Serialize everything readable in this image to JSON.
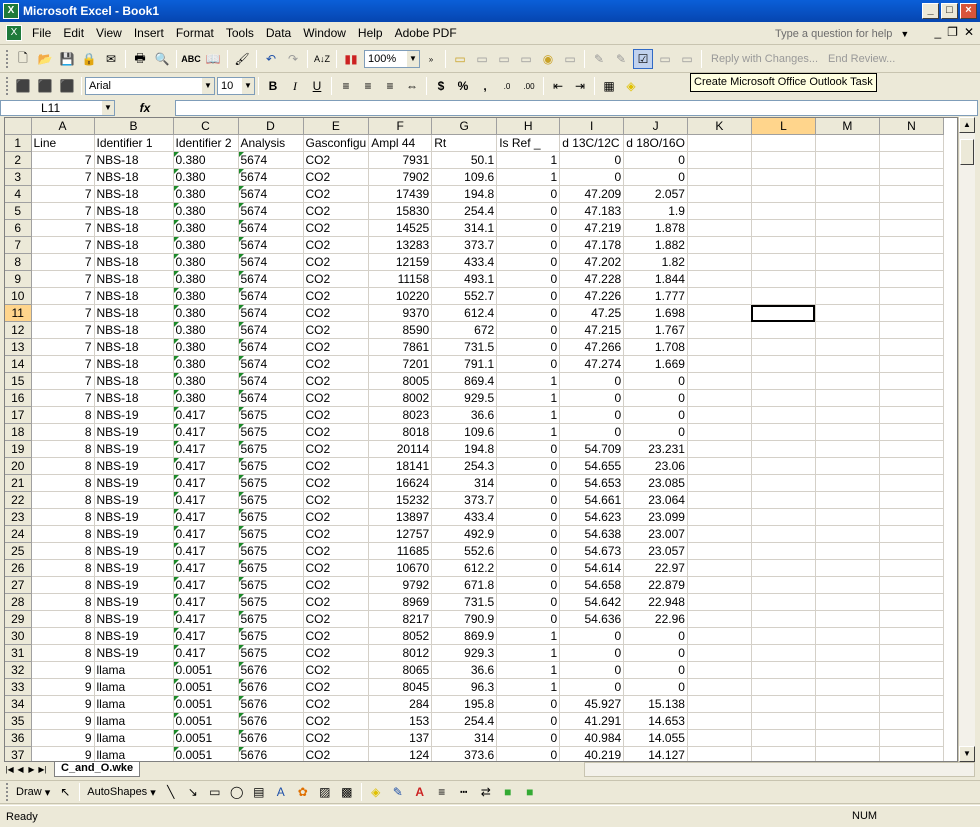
{
  "window": {
    "title": "Microsoft Excel - Book1"
  },
  "menu": [
    "File",
    "Edit",
    "View",
    "Insert",
    "Format",
    "Tools",
    "Data",
    "Window",
    "Help",
    "Adobe PDF"
  ],
  "help": {
    "placeholder": "Type a question for help"
  },
  "toolbar": {
    "zoom": "100%",
    "reply_label": "Reply with Changes...",
    "end_review_label": "End Review...",
    "font": "Arial",
    "size": "10"
  },
  "tooltip": "Create Microsoft Office Outlook Task",
  "namebox": "L11",
  "fx": "fx",
  "columns": [
    "A",
    "B",
    "C",
    "D",
    "E",
    "F",
    "G",
    "H",
    "I",
    "J",
    "K",
    "L",
    "M",
    "N"
  ],
  "rows": [
    [
      "Line",
      "Identifier 1",
      "Identifier 2",
      "Analysis",
      "Gasconfigu",
      "Ampl  44",
      "Rt",
      "Is Ref _",
      "d 13C/12C",
      "d 18O/16O"
    ],
    [
      "7",
      "NBS-18",
      "0.380",
      "5674",
      "CO2",
      "7931",
      "50.1",
      "1",
      "0",
      "0"
    ],
    [
      "7",
      "NBS-18",
      "0.380",
      "5674",
      "CO2",
      "7902",
      "109.6",
      "1",
      "0",
      "0"
    ],
    [
      "7",
      "NBS-18",
      "0.380",
      "5674",
      "CO2",
      "17439",
      "194.8",
      "0",
      "47.209",
      "2.057"
    ],
    [
      "7",
      "NBS-18",
      "0.380",
      "5674",
      "CO2",
      "15830",
      "254.4",
      "0",
      "47.183",
      "1.9"
    ],
    [
      "7",
      "NBS-18",
      "0.380",
      "5674",
      "CO2",
      "14525",
      "314.1",
      "0",
      "47.219",
      "1.878"
    ],
    [
      "7",
      "NBS-18",
      "0.380",
      "5674",
      "CO2",
      "13283",
      "373.7",
      "0",
      "47.178",
      "1.882"
    ],
    [
      "7",
      "NBS-18",
      "0.380",
      "5674",
      "CO2",
      "12159",
      "433.4",
      "0",
      "47.202",
      "1.82"
    ],
    [
      "7",
      "NBS-18",
      "0.380",
      "5674",
      "CO2",
      "11158",
      "493.1",
      "0",
      "47.228",
      "1.844"
    ],
    [
      "7",
      "NBS-18",
      "0.380",
      "5674",
      "CO2",
      "10220",
      "552.7",
      "0",
      "47.226",
      "1.777"
    ],
    [
      "7",
      "NBS-18",
      "0.380",
      "5674",
      "CO2",
      "9370",
      "612.4",
      "0",
      "47.25",
      "1.698"
    ],
    [
      "7",
      "NBS-18",
      "0.380",
      "5674",
      "CO2",
      "8590",
      "672",
      "0",
      "47.215",
      "1.767"
    ],
    [
      "7",
      "NBS-18",
      "0.380",
      "5674",
      "CO2",
      "7861",
      "731.5",
      "0",
      "47.266",
      "1.708"
    ],
    [
      "7",
      "NBS-18",
      "0.380",
      "5674",
      "CO2",
      "7201",
      "791.1",
      "0",
      "47.274",
      "1.669"
    ],
    [
      "7",
      "NBS-18",
      "0.380",
      "5674",
      "CO2",
      "8005",
      "869.4",
      "1",
      "0",
      "0"
    ],
    [
      "7",
      "NBS-18",
      "0.380",
      "5674",
      "CO2",
      "8002",
      "929.5",
      "1",
      "0",
      "0"
    ],
    [
      "8",
      "NBS-19",
      "0.417",
      "5675",
      "CO2",
      "8023",
      "36.6",
      "1",
      "0",
      "0"
    ],
    [
      "8",
      "NBS-19",
      "0.417",
      "5675",
      "CO2",
      "8018",
      "109.6",
      "1",
      "0",
      "0"
    ],
    [
      "8",
      "NBS-19",
      "0.417",
      "5675",
      "CO2",
      "20114",
      "194.8",
      "0",
      "54.709",
      "23.231"
    ],
    [
      "8",
      "NBS-19",
      "0.417",
      "5675",
      "CO2",
      "18141",
      "254.3",
      "0",
      "54.655",
      "23.06"
    ],
    [
      "8",
      "NBS-19",
      "0.417",
      "5675",
      "CO2",
      "16624",
      "314",
      "0",
      "54.653",
      "23.085"
    ],
    [
      "8",
      "NBS-19",
      "0.417",
      "5675",
      "CO2",
      "15232",
      "373.7",
      "0",
      "54.661",
      "23.064"
    ],
    [
      "8",
      "NBS-19",
      "0.417",
      "5675",
      "CO2",
      "13897",
      "433.4",
      "0",
      "54.623",
      "23.099"
    ],
    [
      "8",
      "NBS-19",
      "0.417",
      "5675",
      "CO2",
      "12757",
      "492.9",
      "0",
      "54.638",
      "23.007"
    ],
    [
      "8",
      "NBS-19",
      "0.417",
      "5675",
      "CO2",
      "11685",
      "552.6",
      "0",
      "54.673",
      "23.057"
    ],
    [
      "8",
      "NBS-19",
      "0.417",
      "5675",
      "CO2",
      "10670",
      "612.2",
      "0",
      "54.614",
      "22.97"
    ],
    [
      "8",
      "NBS-19",
      "0.417",
      "5675",
      "CO2",
      "9792",
      "671.8",
      "0",
      "54.658",
      "22.879"
    ],
    [
      "8",
      "NBS-19",
      "0.417",
      "5675",
      "CO2",
      "8969",
      "731.5",
      "0",
      "54.642",
      "22.948"
    ],
    [
      "8",
      "NBS-19",
      "0.417",
      "5675",
      "CO2",
      "8217",
      "790.9",
      "0",
      "54.636",
      "22.96"
    ],
    [
      "8",
      "NBS-19",
      "0.417",
      "5675",
      "CO2",
      "8052",
      "869.9",
      "1",
      "0",
      "0"
    ],
    [
      "8",
      "NBS-19",
      "0.417",
      "5675",
      "CO2",
      "8012",
      "929.3",
      "1",
      "0",
      "0"
    ],
    [
      "9",
      "llama",
      "0.0051",
      "5676",
      "CO2",
      "8065",
      "36.6",
      "1",
      "0",
      "0"
    ],
    [
      "9",
      "llama",
      "0.0051",
      "5676",
      "CO2",
      "8045",
      "96.3",
      "1",
      "0",
      "0"
    ],
    [
      "9",
      "llama",
      "0.0051",
      "5676",
      "CO2",
      "284",
      "195.8",
      "0",
      "45.927",
      "15.138"
    ],
    [
      "9",
      "llama",
      "0.0051",
      "5676",
      "CO2",
      "153",
      "254.4",
      "0",
      "41.291",
      "14.653"
    ],
    [
      "9",
      "llama",
      "0.0051",
      "5676",
      "CO2",
      "137",
      "314",
      "0",
      "40.984",
      "14.055"
    ],
    [
      "9",
      "llama",
      "0.0051",
      "5676",
      "CO2",
      "124",
      "373.6",
      "0",
      "40.219",
      "14.127"
    ]
  ],
  "sheet_tab": "C_and_O.wke",
  "draw": {
    "draw_label": "Draw",
    "autoshapes_label": "AutoShapes"
  },
  "status": {
    "left": "Ready",
    "num": "NUM"
  }
}
